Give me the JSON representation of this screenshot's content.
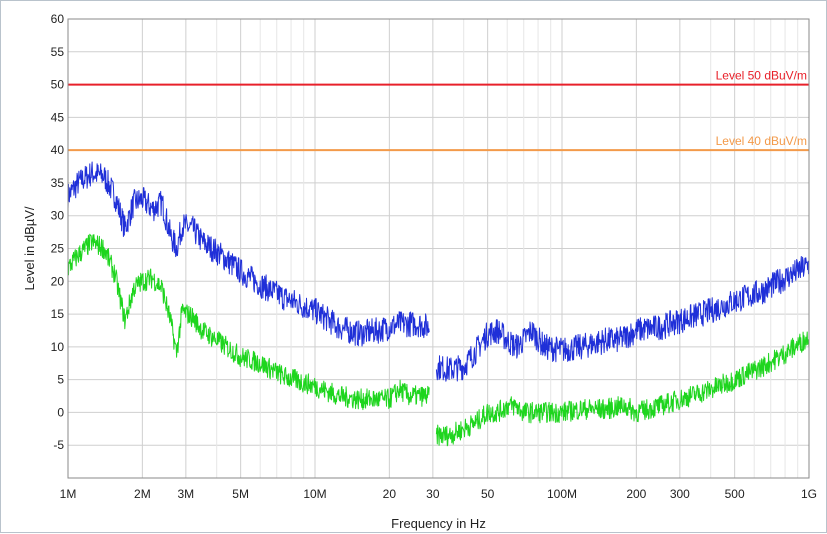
{
  "chart_data": {
    "type": "line",
    "xlabel": "Frequency in Hz",
    "ylabel": "Level in dBµV/",
    "x_scale": "log",
    "xlim": [
      1000000,
      1000000000
    ],
    "ylim": [
      -10,
      60
    ],
    "x_ticks": [
      {
        "value": 1000000,
        "label": "1M"
      },
      {
        "value": 2000000,
        "label": "2M"
      },
      {
        "value": 3000000,
        "label": "3M"
      },
      {
        "value": 5000000,
        "label": "5M"
      },
      {
        "value": 10000000,
        "label": "10M"
      },
      {
        "value": 20000000,
        "label": "20"
      },
      {
        "value": 30000000,
        "label": "30"
      },
      {
        "value": 50000000,
        "label": "50"
      },
      {
        "value": 100000000,
        "label": "100M"
      },
      {
        "value": 200000000,
        "label": "200"
      },
      {
        "value": 300000000,
        "label": "300"
      },
      {
        "value": 500000000,
        "label": "500"
      },
      {
        "value": 1000000000,
        "label": "1G"
      }
    ],
    "y_ticks": [
      -5,
      0,
      5,
      10,
      15,
      20,
      25,
      30,
      35,
      40,
      45,
      50,
      55,
      60
    ],
    "grid": true,
    "reference_lines": [
      {
        "label": "Level 50 dBuV/m",
        "value": 50,
        "color": "#e8202a"
      },
      {
        "label": "Level 40 dBuV/m",
        "value": 40,
        "color": "#f39a4a"
      }
    ],
    "series": [
      {
        "color": "#1f2fd8",
        "noise": 2.0,
        "segments": [
          [
            [
              1000000.0,
              33
            ],
            [
              1100000.0,
              35
            ],
            [
              1250000.0,
              36.5
            ],
            [
              1400000.0,
              36
            ],
            [
              1550000.0,
              33
            ],
            [
              1700000.0,
              28
            ],
            [
              1850000.0,
              32
            ],
            [
              2000000.0,
              32.5
            ],
            [
              2200000.0,
              31
            ],
            [
              2400000.0,
              32
            ],
            [
              2600000.0,
              27
            ],
            [
              2750000.0,
              25
            ],
            [
              2900000.0,
              28.5
            ],
            [
              3200000.0,
              28
            ],
            [
              3500000.0,
              26
            ],
            [
              4000000.0,
              24.5
            ],
            [
              5000000.0,
              21.5
            ],
            [
              6000000.0,
              19.5
            ],
            [
              7500000.0,
              17.5
            ],
            [
              10000000.0,
              15.5
            ],
            [
              12500000.0,
              13
            ],
            [
              15000000.0,
              12
            ],
            [
              18000000.0,
              12.5
            ],
            [
              22000000.0,
              13.5
            ],
            [
              26000000.0,
              13.5
            ],
            [
              29000000.0,
              13
            ]
          ],
          [
            [
              31000000.0,
              7
            ],
            [
              35000000.0,
              6.5
            ],
            [
              40000000.0,
              7
            ],
            [
              45000000.0,
              9.5
            ],
            [
              50000000.0,
              12
            ],
            [
              55000000.0,
              12.5
            ],
            [
              60000000.0,
              11
            ],
            [
              65000000.0,
              10
            ],
            [
              70000000.0,
              11
            ],
            [
              75000000.0,
              12.5
            ],
            [
              85000000.0,
              10
            ],
            [
              100000000.0,
              9.5
            ],
            [
              120000000.0,
              10
            ],
            [
              150000000.0,
              11
            ],
            [
              170000000.0,
              11
            ],
            [
              200000000.0,
              12.5
            ],
            [
              250000000.0,
              13
            ],
            [
              300000000.0,
              14
            ],
            [
              400000000.0,
              15.5
            ],
            [
              500000000.0,
              17
            ],
            [
              650000000.0,
              18.5
            ],
            [
              800000000.0,
              20.5
            ],
            [
              1000000000.0,
              22.5
            ]
          ]
        ]
      },
      {
        "color": "#1ed51e",
        "noise": 1.6,
        "segments": [
          [
            [
              1000000.0,
              22
            ],
            [
              1100000.0,
              24
            ],
            [
              1250000.0,
              26
            ],
            [
              1400000.0,
              25
            ],
            [
              1550000.0,
              21
            ],
            [
              1700000.0,
              14
            ],
            [
              1850000.0,
              19
            ],
            [
              2000000.0,
              20
            ],
            [
              2200000.0,
              20.5
            ],
            [
              2400000.0,
              19
            ],
            [
              2600000.0,
              14
            ],
            [
              2750000.0,
              9
            ],
            [
              2900000.0,
              15.5
            ],
            [
              3200000.0,
              14.5
            ],
            [
              3500000.0,
              12.5
            ],
            [
              4000000.0,
              11
            ],
            [
              5000000.0,
              8.5
            ],
            [
              6000000.0,
              7.5
            ],
            [
              7500000.0,
              5.5
            ],
            [
              10000000.0,
              4
            ],
            [
              12500000.0,
              2.5
            ],
            [
              15000000.0,
              2
            ],
            [
              18000000.0,
              2
            ],
            [
              20000000.0,
              2
            ],
            [
              22000000.0,
              3.5
            ],
            [
              24000000.0,
              2.5
            ],
            [
              26000000.0,
              2.5
            ],
            [
              29000000.0,
              2.5
            ]
          ],
          [
            [
              31000000.0,
              -3.5
            ],
            [
              35000000.0,
              -3.5
            ],
            [
              40000000.0,
              -2.5
            ],
            [
              45000000.0,
              -1.5
            ],
            [
              50000000.0,
              0
            ],
            [
              55000000.0,
              0
            ],
            [
              60000000.0,
              1
            ],
            [
              65000000.0,
              1
            ],
            [
              70000000.0,
              0
            ],
            [
              80000000.0,
              0
            ],
            [
              100000000.0,
              0
            ],
            [
              120000000.0,
              0.5
            ],
            [
              150000000.0,
              0.5
            ],
            [
              180000000.0,
              1
            ],
            [
              200000000.0,
              0
            ],
            [
              250000000.0,
              1
            ],
            [
              300000000.0,
              2
            ],
            [
              400000000.0,
              3.5
            ],
            [
              500000000.0,
              5
            ],
            [
              650000000.0,
              7
            ],
            [
              800000000.0,
              9
            ],
            [
              1000000000.0,
              11.5
            ]
          ]
        ]
      }
    ]
  }
}
